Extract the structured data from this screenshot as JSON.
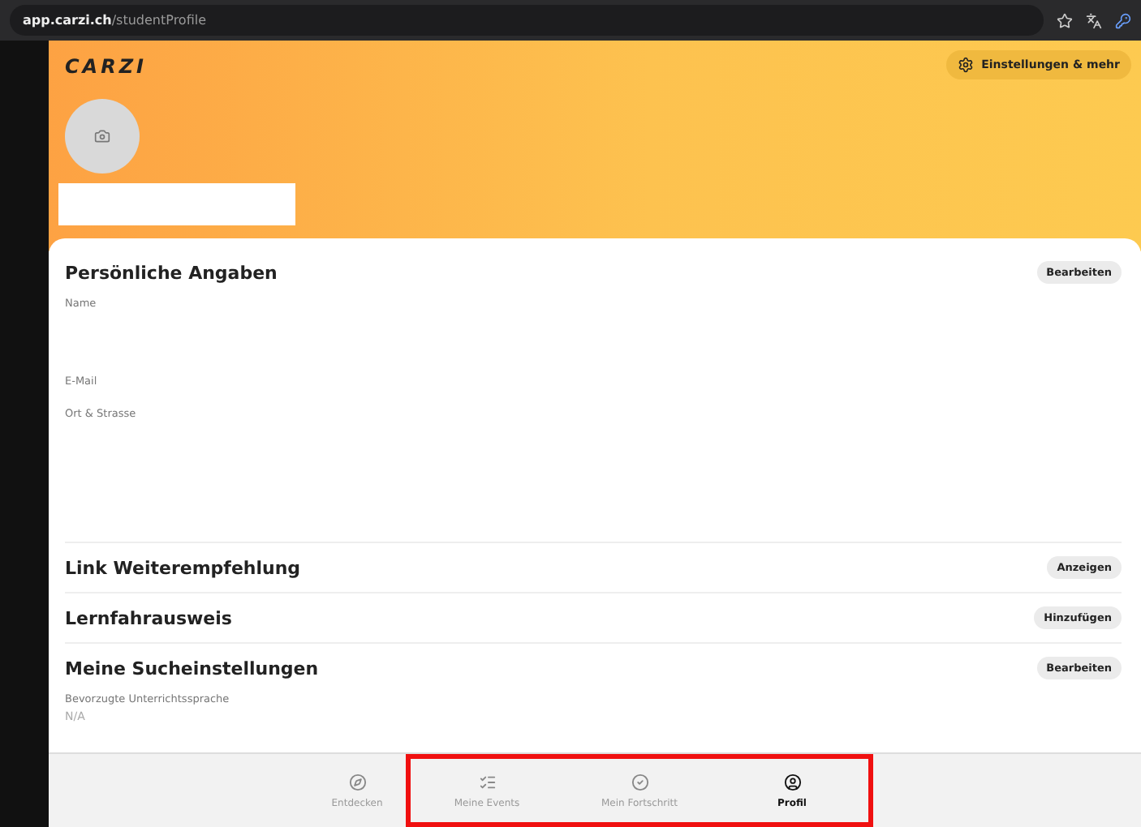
{
  "browser": {
    "url_host": "app.carzi.ch",
    "url_path": "/studentProfile"
  },
  "header": {
    "logo": "CARZI",
    "settings_button": "Einstellungen & mehr"
  },
  "sections": [
    {
      "title": "Persönliche Angaben",
      "action": "Bearbeiten",
      "fields": [
        {
          "label": "Name"
        },
        {
          "label": "E-Mail"
        },
        {
          "label": "Ort & Strasse"
        }
      ]
    },
    {
      "title": "Link Weiterempfehlung",
      "action": "Anzeigen"
    },
    {
      "title": "Lernfahrausweis",
      "action": "Hinzufügen"
    },
    {
      "title": "Meine Sucheinstellungen",
      "action": "Bearbeiten",
      "fields": [
        {
          "label": "Bevorzugte Unterrichtssprache",
          "value": "N/A"
        }
      ]
    }
  ],
  "nav": [
    {
      "label": "Entdecken",
      "selected": false,
      "highlighted": false
    },
    {
      "label": "Meine Events",
      "selected": false,
      "highlighted": true
    },
    {
      "label": "Mein Fortschritt",
      "selected": false,
      "highlighted": true
    },
    {
      "label": "Profil",
      "selected": true,
      "highlighted": true
    }
  ]
}
